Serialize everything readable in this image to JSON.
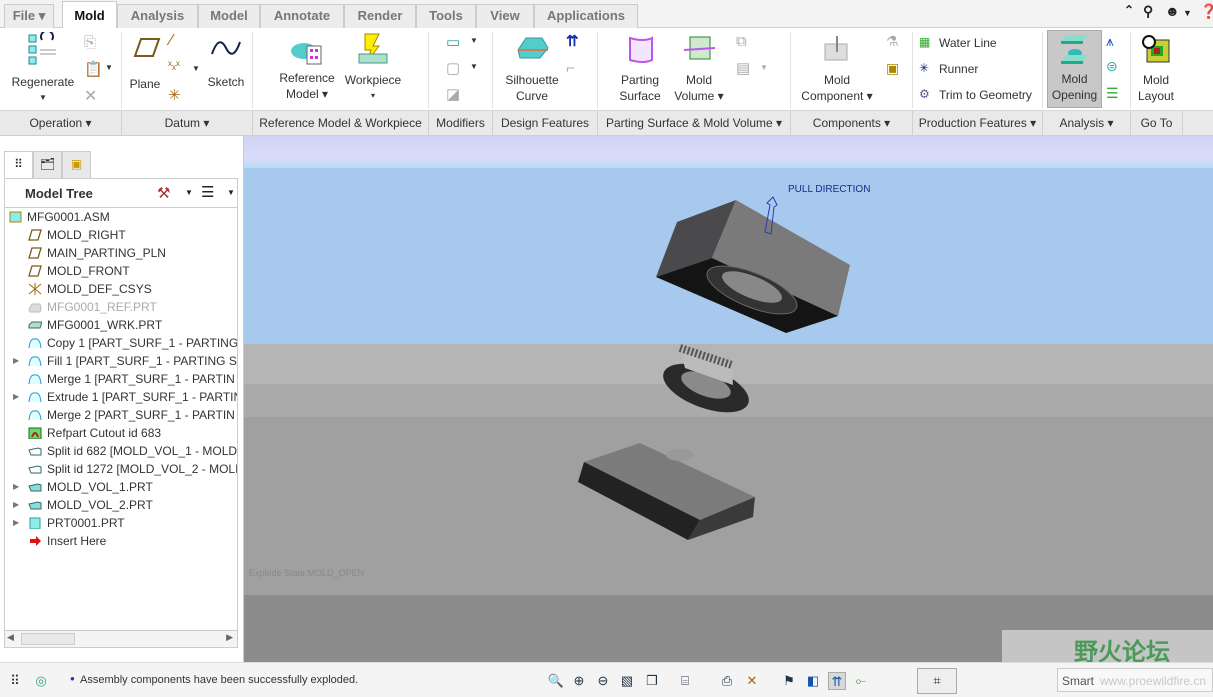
{
  "tabs": [
    {
      "label": "File ▾"
    },
    {
      "label": "Mold"
    },
    {
      "label": "Analysis"
    },
    {
      "label": "Model"
    },
    {
      "label": "Annotate"
    },
    {
      "label": "Render"
    },
    {
      "label": "Tools"
    },
    {
      "label": "View"
    },
    {
      "label": "Applications"
    }
  ],
  "active_tab": "Mold",
  "ribbon": {
    "regenerate": "Regenerate",
    "plane": "Plane",
    "sketch": "Sketch",
    "reference_model": [
      "Reference",
      "Model ▾"
    ],
    "workpiece": [
      "Workpiece",
      "▾"
    ],
    "silhouette_curve": [
      "Silhouette",
      "Curve"
    ],
    "parting_surface": [
      "Parting",
      "Surface"
    ],
    "mold_volume": [
      "Mold",
      "Volume ▾"
    ],
    "mold_component": [
      "Mold",
      "Component ▾"
    ],
    "water_line": "Water Line",
    "runner": "Runner",
    "trim_to_geometry": "Trim to Geometry",
    "mold_opening": [
      "Mold",
      "Opening"
    ],
    "mold_layout": [
      "Mold",
      "Layout"
    ]
  },
  "groups": [
    "Operation ▾",
    "Datum ▾",
    "Reference Model & Workpiece",
    "Modifiers",
    "Design Features",
    "Parting Surface & Mold Volume ▾",
    "Components ▾",
    "Production Features ▾",
    "Analysis ▾",
    "Go To"
  ],
  "model_tree": {
    "title": "Model Tree",
    "items": [
      {
        "label": "MFG0001.ASM",
        "icon": "assembly-icon",
        "expand": false
      },
      {
        "label": "MOLD_RIGHT",
        "icon": "datum-plane-icon",
        "expand": false
      },
      {
        "label": "MAIN_PARTING_PLN",
        "icon": "datum-plane-icon",
        "expand": false
      },
      {
        "label": "MOLD_FRONT",
        "icon": "datum-plane-icon",
        "expand": false
      },
      {
        "label": "MOLD_DEF_CSYS",
        "icon": "csys-icon",
        "expand": false
      },
      {
        "label": "MFG0001_REF.PRT",
        "icon": "ref-part-icon",
        "expand": false,
        "dim": true
      },
      {
        "label": "MFG0001_WRK.PRT",
        "icon": "workpiece-icon",
        "expand": false
      },
      {
        "label": "Copy 1 [PART_SURF_1 - PARTING",
        "icon": "surface-icon",
        "expand": false
      },
      {
        "label": "Fill 1 [PART_SURF_1 - PARTING S",
        "icon": "surface-icon",
        "expand": true
      },
      {
        "label": "Merge 1 [PART_SURF_1 - PARTIN",
        "icon": "surface-icon",
        "expand": false
      },
      {
        "label": "Extrude 1 [PART_SURF_1 - PARTIN",
        "icon": "surface-icon",
        "expand": true
      },
      {
        "label": "Merge 2 [PART_SURF_1 - PARTIN",
        "icon": "surface-icon",
        "expand": false
      },
      {
        "label": "Refpart Cutout id 683",
        "icon": "cutout-icon",
        "expand": false
      },
      {
        "label": "Split id 682 [MOLD_VOL_1 - MOLD",
        "icon": "split-icon",
        "expand": false
      },
      {
        "label": "Split id 1272 [MOLD_VOL_2 - MOLI",
        "icon": "split-icon",
        "expand": false
      },
      {
        "label": "MOLD_VOL_1.PRT",
        "icon": "mold-volume-icon",
        "expand": true
      },
      {
        "label": "MOLD_VOL_2.PRT",
        "icon": "mold-volume-icon",
        "expand": true
      },
      {
        "label": "PRT0001.PRT",
        "icon": "part-icon",
        "expand": true
      },
      {
        "label": "Insert Here",
        "icon": "insert-arrow-icon",
        "expand": false
      }
    ]
  },
  "viewport": {
    "pull_direction": "PULL DIRECTION",
    "explode_state": "Explode State:MOLD_OPEN",
    "watermark": "野火论坛",
    "watermark_url": "www.proewildfire.cn"
  },
  "status": {
    "message": "Assembly components have been successfully exploded.",
    "filter": "Smart"
  },
  "colors": {
    "sky": "#a8c9ee",
    "accent_pull": "#1a2a8a",
    "active_btn": "#c8c8c8"
  }
}
